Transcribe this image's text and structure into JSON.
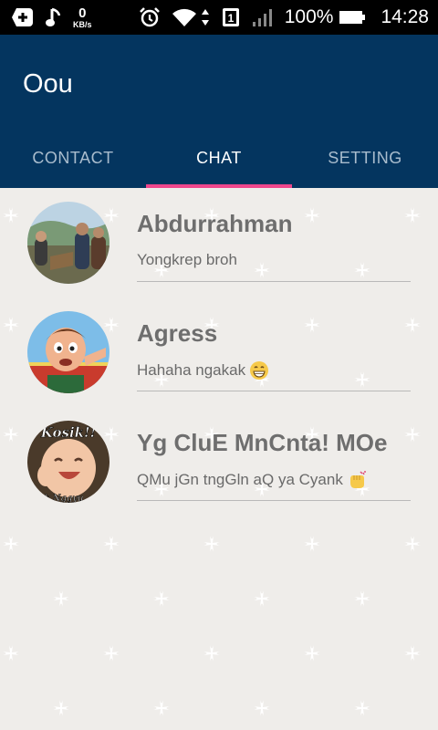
{
  "status_bar": {
    "net_speed_value": "0",
    "net_speed_unit": "KB/s",
    "sim_slot": "1",
    "battery": "100%",
    "time": "14:28",
    "icons": [
      "add-notification-icon",
      "music-note-icon",
      "alarm-icon",
      "wifi-icon",
      "data-arrows-icon",
      "sim-icon",
      "signal-icon",
      "battery-icon"
    ]
  },
  "app": {
    "title": "Oou",
    "accent": "#f0468c",
    "toolbar_color": "#04355f"
  },
  "tabs": [
    {
      "label": "CONTACT",
      "active": false
    },
    {
      "label": "CHAT",
      "active": true
    },
    {
      "label": "SETTING",
      "active": false
    }
  ],
  "chats": [
    {
      "name": "Abdurrahman",
      "message": "Yongkrep broh",
      "avatar": "group-photo",
      "emoji": ""
    },
    {
      "name": "Agress",
      "message": "Hahaha ngakak",
      "avatar": "cartoon-boy",
      "emoji": "grinning-emoji"
    },
    {
      "name": "Yg CluE MnCnta! MOe",
      "message": "QMu jGn tngGln aQ ya Cyank",
      "avatar": "laughing-baby",
      "emoji": "hand-emoji",
      "avatar_text_top": "Kosik!!",
      "avatar_text_bottom": "k Nggyu"
    }
  ]
}
